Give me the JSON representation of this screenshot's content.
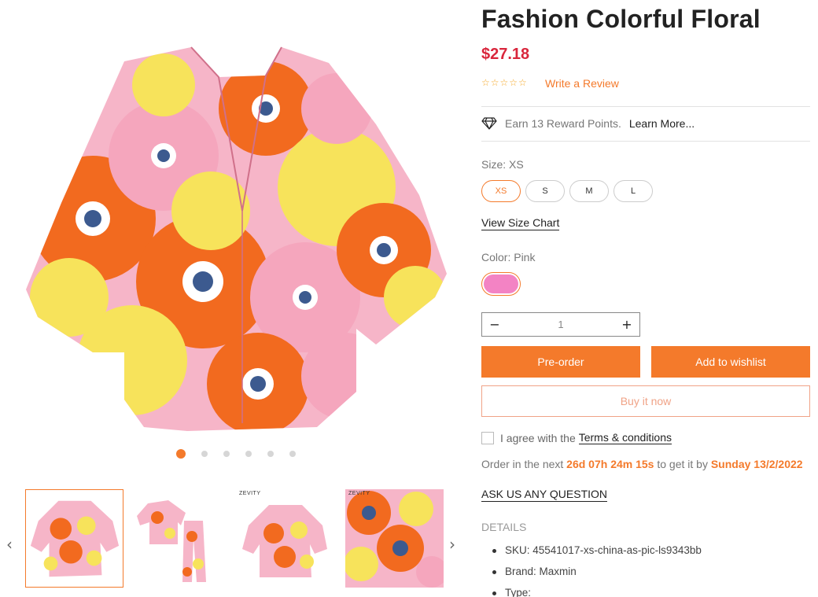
{
  "product": {
    "title": "Fashion Colorful Floral",
    "price": "$27.18",
    "rating_stars": "☆☆☆☆☆",
    "write_review": "Write a Review"
  },
  "reward": {
    "text": "Earn 13 Reward Points.",
    "learn_more": "Learn More..."
  },
  "size": {
    "label": "Size: XS",
    "options": [
      "XS",
      "S",
      "M",
      "L"
    ],
    "selected": "XS",
    "chart_link": "View Size Chart"
  },
  "color": {
    "label": "Color: Pink",
    "swatch": "#f383c4"
  },
  "quantity": {
    "minus": "−",
    "value": "1",
    "plus": "+"
  },
  "buttons": {
    "preorder": "Pre-order",
    "wishlist": "Add to wishlist",
    "buy_now": "Buy it now"
  },
  "terms": {
    "prefix": "I agree with the",
    "link": "Terms & conditions"
  },
  "order": {
    "prefix": "Order in the next",
    "countdown": "26d 07h 24m 15s",
    "middle": "to get it by",
    "date": "Sunday 13/2/2022"
  },
  "ask_question": "ASK US ANY QUESTION",
  "details": {
    "heading": "DETAILS",
    "items": [
      "SKU: 45541017-xs-china-as-pic-ls9343bb",
      "Brand: Maxmin",
      "Type:"
    ]
  },
  "gallery": {
    "prev": "‹",
    "next": "›",
    "thumb_brand": "ZEVITY"
  },
  "colors": {
    "accent": "#f47a2b",
    "price": "#d9263c"
  }
}
